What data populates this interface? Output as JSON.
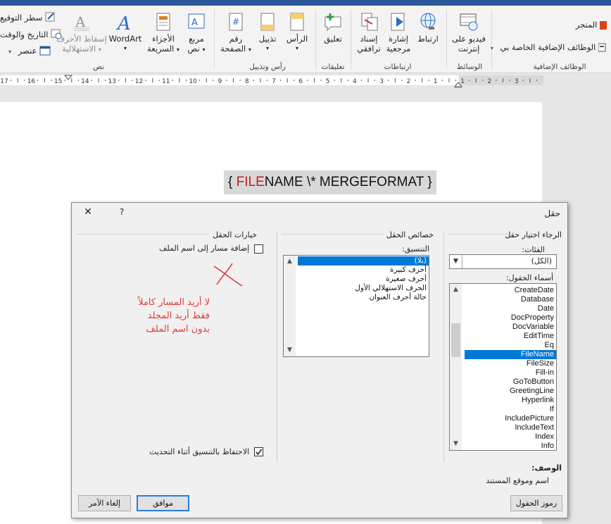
{
  "ribbon": {
    "groups": {
      "text": "نص",
      "header_footer": "رأس وتذييل",
      "comments": "تعليقات",
      "links": "ارتباطات",
      "media": "الوسائط",
      "addins": "الوظائف الإضافية"
    },
    "buttons": {
      "signature_line": "سطر التوقيع",
      "date_time": "التاريخ والوقت",
      "object": "عنصر",
      "drop_cap_1": "إسقاط الأحرف",
      "drop_cap_2": "الاستهلالية",
      "wordart": "WordArt",
      "quick_parts_1": "الأجزاء",
      "quick_parts_2": "السريعة",
      "text_box_1": "مربع",
      "text_box_2": "نص",
      "page_number_1": "رقم",
      "page_number_2": "الصفحة",
      "footer": "تذييل",
      "header": "الرأس",
      "comment": "تعليق",
      "cross_reference_1": "إسناد",
      "cross_reference_2": "ترافقي",
      "bookmark_1": "إشارة",
      "bookmark_2": "مرجعية",
      "link": "ارتباط",
      "online_video_1": "فيديو على",
      "online_video_2": "إنترنت",
      "store": "المتجر",
      "my_addins": "الوظائف الإضافية الخاصة بي"
    },
    "icons": {
      "text_box": "text-box-icon",
      "quick_parts": "quick-parts-icon",
      "wordart": "wordart-icon",
      "page_number": "page-number-icon",
      "footer": "footer-icon",
      "header": "header-icon",
      "comment": "comment-icon",
      "cross_reference": "cross-reference-icon",
      "bookmark": "bookmark-icon",
      "link": "link-icon",
      "online_video": "online-video-icon",
      "store": "store-icon",
      "my_addins": "my-addins-icon"
    }
  },
  "ruler": {
    "labels": [
      "17",
      "16",
      "15",
      "14",
      "13",
      "12",
      "11",
      "10",
      "9",
      "8",
      "7",
      "6",
      "5",
      "4",
      "3",
      "2",
      "1",
      "1",
      "2",
      "3"
    ]
  },
  "document": {
    "field_open": "{",
    "field_red": "FILE",
    "field_rest": "NAME  \\* MERGEFORMAT",
    "field_close": "}"
  },
  "dialog": {
    "title": "حقل",
    "help": "?",
    "close": "✕",
    "choose_section": "الرجاء اختيار حقل",
    "categories_label": "الفئات:",
    "categories_value": "(الكل)",
    "field_names_label": "أسماء الحقول:",
    "field_names": [
      "CreateDate",
      "Database",
      "Date",
      "DocProperty",
      "DocVariable",
      "EditTime",
      "Eq",
      "FileName",
      "FileSize",
      "Fill-in",
      "GoToButton",
      "GreetingLine",
      "Hyperlink",
      "If",
      "IncludePicture",
      "IncludeText",
      "Index",
      "Info"
    ],
    "selected_field": "FileName",
    "properties_section": "خصائص الحقل",
    "format_label": "التنسيق:",
    "formats": [
      "(بلا)",
      "أحرف كبيرة",
      "أحرف صغيرة",
      "الحرف الاستهلالي الأول",
      "حالة أحرف العنوان"
    ],
    "selected_format": "(بلا)",
    "options_section": "خيارات الحقل",
    "add_path_label": "إضافة مسار إلى اسم الملف",
    "add_path_checked": false,
    "preserve_label": "الاحتفاظ بالتنسيق أثناء التحديث",
    "preserve_checked": true,
    "description_label": "الوصف:",
    "description": "اسم وموقع المستند",
    "field_codes_button": "رموز الحقول",
    "ok_button": "موافق",
    "cancel_button": "إلغاء الأمر",
    "annotation": [
      "لا أريد المسار كاملاً",
      "فقط أريد المجلد",
      "بدون اسم الملف"
    ],
    "annotation_color": "#e23b3b",
    "selection_color": "#0078d7"
  }
}
